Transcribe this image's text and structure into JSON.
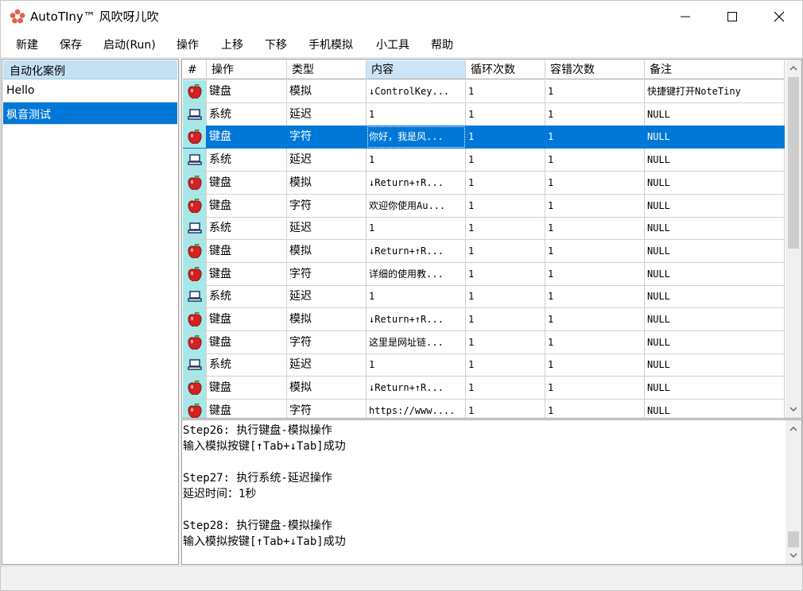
{
  "window": {
    "title": "AutoTIny™ 风吹呀儿吹",
    "icon": "maple-leaf-icon",
    "accent": "#e2624f"
  },
  "menu": [
    "新建",
    "保存",
    "启动(Run)",
    "操作",
    "上移",
    "下移",
    "手机模拟",
    "小工具",
    "帮助"
  ],
  "cases": {
    "header": "自动化案例",
    "items": [
      {
        "label": "Hello",
        "selected": false
      },
      {
        "label": "枫音测试",
        "selected": true
      }
    ]
  },
  "grid": {
    "columns": [
      "#",
      "操作",
      "类型",
      "内容",
      "循环次数",
      "容错次数",
      "备注"
    ],
    "rows": [
      {
        "icon": "apple-icon",
        "op": "键盘",
        "type": "模拟",
        "content": "↓ControlKey...",
        "loop": "1",
        "retry": "1",
        "note": "快捷键打开NoteTiny"
      },
      {
        "icon": "monitor-icon",
        "op": "系统",
        "type": "延迟",
        "content": "1",
        "loop": "1",
        "retry": "1",
        "note": "NULL"
      },
      {
        "icon": "apple-icon",
        "op": "键盘",
        "type": "字符",
        "content": "你好，我是风...",
        "loop": "1",
        "retry": "1",
        "note": "NULL",
        "selected": true
      },
      {
        "icon": "monitor-icon",
        "op": "系统",
        "type": "延迟",
        "content": "1",
        "loop": "1",
        "retry": "1",
        "note": "NULL"
      },
      {
        "icon": "apple-icon",
        "op": "键盘",
        "type": "模拟",
        "content": "↓Return+↑R...",
        "loop": "1",
        "retry": "1",
        "note": "NULL"
      },
      {
        "icon": "apple-icon",
        "op": "键盘",
        "type": "字符",
        "content": "欢迎你使用Au...",
        "loop": "1",
        "retry": "1",
        "note": "NULL"
      },
      {
        "icon": "monitor-icon",
        "op": "系统",
        "type": "延迟",
        "content": "1",
        "loop": "1",
        "retry": "1",
        "note": "NULL"
      },
      {
        "icon": "apple-icon",
        "op": "键盘",
        "type": "模拟",
        "content": "↓Return+↑R...",
        "loop": "1",
        "retry": "1",
        "note": "NULL"
      },
      {
        "icon": "apple-icon",
        "op": "键盘",
        "type": "字符",
        "content": "详细的使用教...",
        "loop": "1",
        "retry": "1",
        "note": "NULL"
      },
      {
        "icon": "monitor-icon",
        "op": "系统",
        "type": "延迟",
        "content": "1",
        "loop": "1",
        "retry": "1",
        "note": "NULL"
      },
      {
        "icon": "apple-icon",
        "op": "键盘",
        "type": "模拟",
        "content": "↓Return+↑R...",
        "loop": "1",
        "retry": "1",
        "note": "NULL"
      },
      {
        "icon": "apple-icon",
        "op": "键盘",
        "type": "字符",
        "content": "这里是网址链...",
        "loop": "1",
        "retry": "1",
        "note": "NULL"
      },
      {
        "icon": "monitor-icon",
        "op": "系统",
        "type": "延迟",
        "content": "1",
        "loop": "1",
        "retry": "1",
        "note": "NULL"
      },
      {
        "icon": "apple-icon",
        "op": "键盘",
        "type": "模拟",
        "content": "↓Return+↑R...",
        "loop": "1",
        "retry": "1",
        "note": "NULL"
      },
      {
        "icon": "apple-icon",
        "op": "键盘",
        "type": "字符",
        "content": "https://www....",
        "loop": "1",
        "retry": "1",
        "note": "NULL"
      }
    ]
  },
  "log": {
    "lines": [
      "Step26: 执行键盘-模拟操作",
      "输入模拟按键[↑Tab+↓Tab]成功",
      "",
      "Step27: 执行系统-延迟操作",
      "延迟时间：1秒",
      "",
      "Step28: 执行键盘-模拟操作",
      "输入模拟按键[↑Tab+↓Tab]成功"
    ]
  },
  "colors": {
    "selection": "#0078d7",
    "icon_cell": "#a6e8e8",
    "header_active": "#cce4f7",
    "case_header": "#c4e0f4"
  }
}
